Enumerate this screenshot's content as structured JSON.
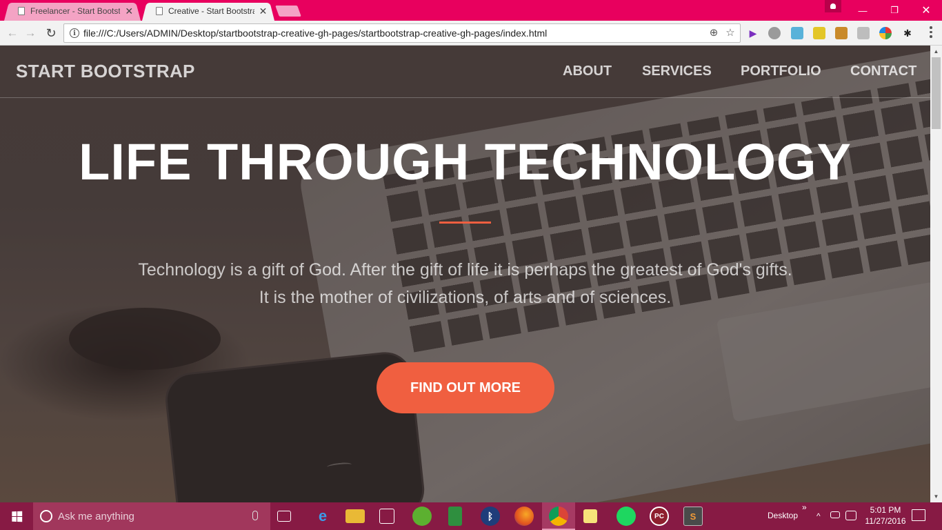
{
  "browser": {
    "tabs": [
      {
        "title": "Freelancer - Start Bootstr",
        "close": "✕"
      },
      {
        "title": "Creative - Start Bootstrap",
        "close": "✕"
      }
    ],
    "url": "file:///C:/Users/ADMIN/Desktop/startbootstrap-creative-gh-pages/startbootstrap-creative-gh-pages/index.html",
    "window_controls": {
      "minimize": "—",
      "maximize": "❐",
      "close": "✕"
    },
    "nav_icons": {
      "back": "←",
      "forward": "→",
      "reload": "↻",
      "zoom": "⊕",
      "star": "☆"
    },
    "accent_color": "#e8005e"
  },
  "page": {
    "brand": "START BOOTSTRAP",
    "nav": [
      "ABOUT",
      "SERVICES",
      "PORTFOLIO",
      "CONTACT"
    ],
    "headline": "LIFE THROUGH TECHNOLOGY",
    "tagline": "Technology is a gift of God. After the gift of life it is perhaps the greatest of God's gifts. It is the mother of civilizations, of arts and of sciences.",
    "cta": "FIND OUT MORE",
    "primary_color": "#f05f40"
  },
  "taskbar": {
    "search_placeholder": "Ask me anything",
    "desktop_label": "Desktop",
    "time": "5:01 PM",
    "date": "11/27/2016",
    "chevron": "»",
    "tray_up": "^",
    "pinned": [
      "task-view",
      "edge",
      "file-explorer",
      "store",
      "evernote-like",
      "notepad-green",
      "bluetooth",
      "firefox",
      "chrome",
      "sticky-notes",
      "spotify",
      "pc-app",
      "sublime-text"
    ]
  }
}
